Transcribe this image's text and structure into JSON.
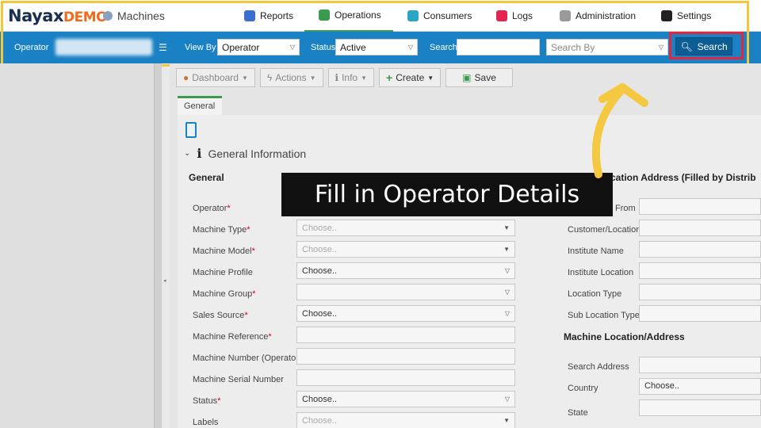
{
  "app": {
    "brand": "Nayax",
    "brand_suffix": "DEMO",
    "module": "Machines"
  },
  "nav": {
    "reports": "Reports",
    "operations": "Operations",
    "consumers": "Consumers",
    "logs": "Logs",
    "administration": "Administration",
    "settings": "Settings"
  },
  "filters": {
    "operator_label": "Operator",
    "viewby_label": "View By",
    "viewby_value": "Operator",
    "status_label": "Status",
    "status_value": "Active",
    "search_label": "Search",
    "search_value": "",
    "searchby_placeholder": "Search By",
    "search_button": "Search"
  },
  "toolbar": {
    "dashboard": "Dashboard",
    "actions": "Actions",
    "info": "Info",
    "create": "Create",
    "save": "Save"
  },
  "tabs": {
    "general": "General"
  },
  "section": {
    "title": "General Information"
  },
  "left_form": {
    "heading": "General",
    "fields": [
      {
        "label": "Operator",
        "required": "*",
        "value": "",
        "placeholder": ""
      },
      {
        "label": "Machine Type",
        "required": "*",
        "value": "Choose..",
        "placeholder": "yes"
      },
      {
        "label": "Machine Model",
        "required": "*",
        "value": "Choose..",
        "placeholder": "yes"
      },
      {
        "label": "Machine Profile",
        "required": "",
        "value": "Choose..",
        "placeholder": ""
      },
      {
        "label": "Machine Group",
        "required": "*",
        "value": "",
        "placeholder": ""
      },
      {
        "label": "Sales Source",
        "required": "*",
        "value": "Choose..",
        "placeholder": ""
      },
      {
        "label": "Machine Reference",
        "required": "*",
        "value": "",
        "placeholder": ""
      },
      {
        "label": "Machine Number (Operator)",
        "required": "",
        "value": "",
        "placeholder": ""
      },
      {
        "label": "Machine Serial Number",
        "required": "",
        "value": "",
        "placeholder": ""
      },
      {
        "label": "Status",
        "required": "*",
        "value": "Choose..",
        "placeholder": ""
      },
      {
        "label": "Labels",
        "required": "",
        "value": "Choose..",
        "placeholder": "yes"
      }
    ]
  },
  "right_form": {
    "heading_fragment": "cation Address (Filled by Distrib",
    "fields": [
      {
        "label": "From",
        "value": ""
      },
      {
        "label": "Customer/Location",
        "value": ""
      },
      {
        "label": "Institute Name",
        "value": ""
      },
      {
        "label": "Institute Location",
        "value": ""
      },
      {
        "label": "Location Type",
        "value": ""
      },
      {
        "label": "Sub Location Type",
        "value": ""
      }
    ],
    "heading2": "Machine Location/Address",
    "fields2": [
      {
        "label": "Search Address",
        "value": ""
      },
      {
        "label": "Country",
        "value": "Choose.."
      },
      {
        "label": "State",
        "value": ""
      }
    ]
  },
  "overlay": {
    "caption": "Fill in Operator Details"
  },
  "colors": {
    "accent_blue": "#1a82c4",
    "highlight_red": "#e0273d",
    "highlight_yellow": "#f3c73b",
    "arrow_yellow": "#f5c842"
  }
}
